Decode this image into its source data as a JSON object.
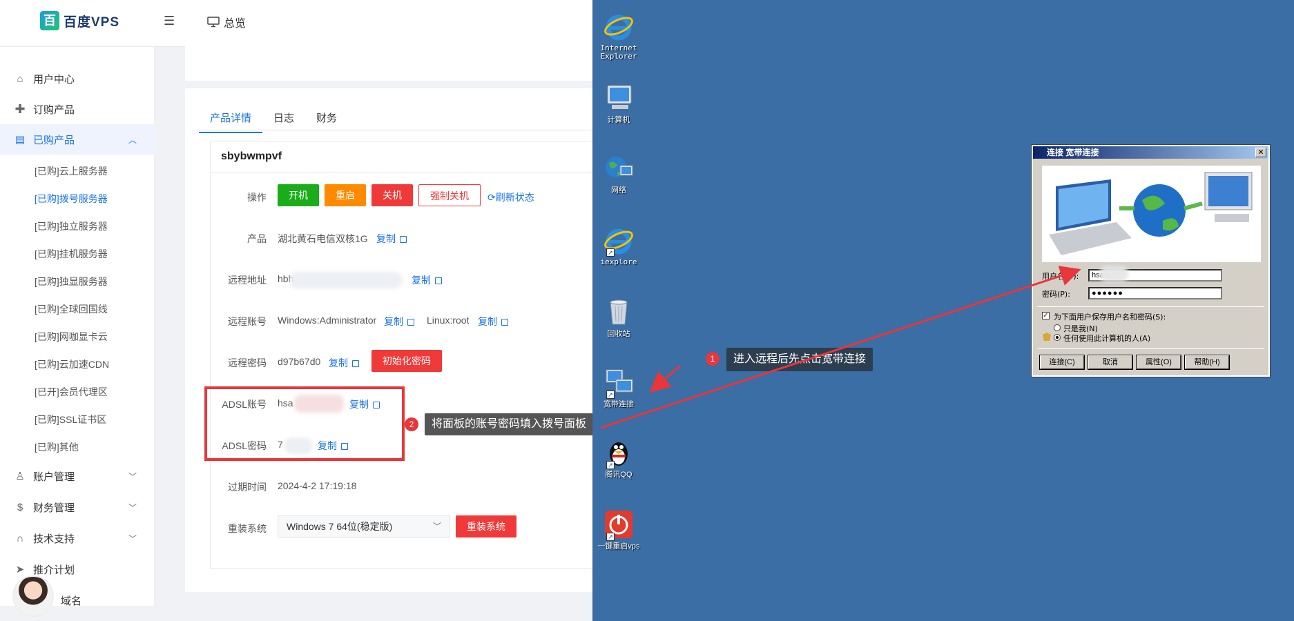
{
  "topbar": {
    "logo_mark": "百",
    "logo_text": "百度VPS",
    "menu_toggle_icon": "menu-fold-icon",
    "overview_label": "总览"
  },
  "sidebar": {
    "items": [
      {
        "label": "用户中心",
        "icon": "home-icon"
      },
      {
        "label": "订购产品",
        "icon": "plus-icon"
      },
      {
        "label": "已购产品",
        "icon": "server-icon"
      },
      {
        "label": "账户管理",
        "icon": "user-icon"
      },
      {
        "label": "财务管理",
        "icon": "dollar-icon"
      },
      {
        "label": "技术支持",
        "icon": "headset-icon"
      },
      {
        "label": "推介计划",
        "icon": "send-icon"
      },
      {
        "label": "域名",
        "icon": "globe-icon"
      }
    ],
    "subitems": [
      "[已购]云上服务器",
      "[已购]拨号服务器",
      "[已购]独立服务器",
      "[已购]挂机服务器",
      "[已购]独显服务器",
      "[已购]全球回国线",
      "[已购]网咖显卡云",
      "[已购]云加速CDN",
      "[已开]会员代理区",
      "[已购]SSL证书区",
      "[已购]其他"
    ],
    "selected_sub": "[已购]拨号服务器"
  },
  "tabs": [
    "产品详情",
    "日志",
    "财务"
  ],
  "product": {
    "name": "sbybwmpvf",
    "op_label": "操作",
    "btn_on": "开机",
    "btn_restart": "重启",
    "btn_off": "关机",
    "btn_force_off": "强制关机",
    "refresh": "刷新状态",
    "product_label": "产品",
    "product_value": "湖北黄石电信双核1G",
    "remote_addr_label": "远程地址",
    "remote_addr_value": "hbh",
    "remote_acct_label": "远程账号",
    "remote_acct_win": "Windows:Administrator",
    "remote_acct_linux": "Linux:root",
    "remote_pwd_label": "远程密码",
    "remote_pwd_value": "d97b67d0",
    "init_pwd": "初始化密码",
    "adsl_acct_label": "ADSL账号",
    "adsl_acct_value": "hsa",
    "adsl_pwd_label": "ADSL密码",
    "adsl_pwd_value": "7",
    "expire_label": "过期时间",
    "expire_value": "2024-4-2 17:19:18",
    "reinstall_label": "重装系统",
    "os_selected": "Windows 7 64位(稳定版)",
    "reinstall_btn": "重装系统",
    "copy": "复制"
  },
  "annotations": {
    "badge1": "1",
    "tip1": "进入远程后先点击宽带连接",
    "badge2": "2",
    "tip2": "将面板的账号密码填入拨号面板"
  },
  "desktop": {
    "icons": [
      {
        "label": "Internet Explorer"
      },
      {
        "label": "计算机"
      },
      {
        "label": "网络"
      },
      {
        "label": "iexplore"
      },
      {
        "label": "回收站"
      },
      {
        "label": "宽带连接"
      },
      {
        "label": "腾讯QQ"
      },
      {
        "label": "一键重启vps"
      }
    ]
  },
  "dialog": {
    "title": "连接 宽带连接",
    "close": "✕",
    "username_label": "用户名(U):",
    "username_value": "hsa",
    "password_label": "密码(P):",
    "password_value": "●●●●●●",
    "save_label": "为下面用户保存用户名和密码(S):",
    "radio_me": "只是我(N)",
    "radio_any": "任何使用此计算机的人(A)",
    "btn_connect": "连接(C)",
    "btn_cancel": "取消",
    "btn_props": "属性(O)",
    "btn_help": "帮助(H)"
  },
  "colors": {
    "accent": "#1a73e8",
    "green": "#1aad19",
    "orange": "#ff8a00",
    "red": "#f03a3a",
    "desktop": "#3a6ea5"
  }
}
